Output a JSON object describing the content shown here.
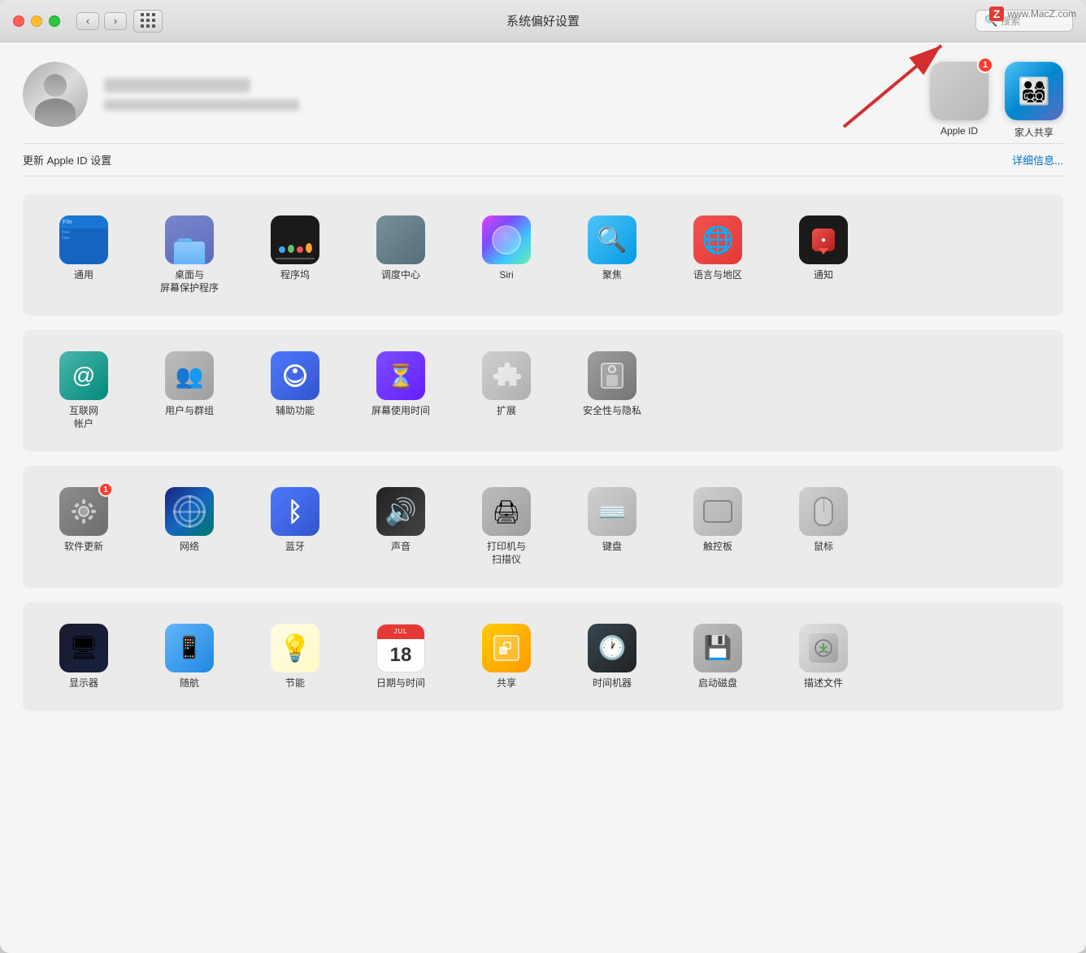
{
  "window": {
    "title": "系统偏好设置",
    "watermark": "www.MacZ.com"
  },
  "titlebar": {
    "back_label": "‹",
    "forward_label": "›",
    "search_placeholder": "搜索"
  },
  "profile": {
    "update_text": "更新 Apple ID 设置",
    "update_link": "详细信息..."
  },
  "top_icons": [
    {
      "id": "apple-id",
      "label": "Apple ID",
      "badge": "1"
    },
    {
      "id": "family-sharing",
      "label": "家人共享"
    }
  ],
  "sections": [
    {
      "id": "section1",
      "items": [
        {
          "id": "general",
          "label": "通用"
        },
        {
          "id": "desktop",
          "label": "桌面与\n屏幕保护程序"
        },
        {
          "id": "dock",
          "label": "程序坞"
        },
        {
          "id": "mission",
          "label": "调度中心"
        },
        {
          "id": "siri",
          "label": "Siri"
        },
        {
          "id": "spotlight",
          "label": "聚焦"
        },
        {
          "id": "language",
          "label": "语言与地区"
        },
        {
          "id": "notification",
          "label": "通知"
        }
      ]
    },
    {
      "id": "section2",
      "items": [
        {
          "id": "internet",
          "label": "互联网\n帐户"
        },
        {
          "id": "users",
          "label": "用户与群组"
        },
        {
          "id": "accessibility",
          "label": "辅助功能"
        },
        {
          "id": "screentime",
          "label": "屏幕使用时间"
        },
        {
          "id": "extensions",
          "label": "扩展"
        },
        {
          "id": "security",
          "label": "安全性与隐私"
        }
      ]
    },
    {
      "id": "section3",
      "items": [
        {
          "id": "softwareupdate",
          "label": "软件更新",
          "badge": "1"
        },
        {
          "id": "network",
          "label": "网络"
        },
        {
          "id": "bluetooth",
          "label": "蓝牙"
        },
        {
          "id": "sound",
          "label": "声音"
        },
        {
          "id": "printer",
          "label": "打印机与\n扫描仪"
        },
        {
          "id": "keyboard",
          "label": "键盘"
        },
        {
          "id": "trackpad",
          "label": "触控板"
        },
        {
          "id": "mouse",
          "label": "鼠标"
        }
      ]
    },
    {
      "id": "section4",
      "items": [
        {
          "id": "display",
          "label": "显示器"
        },
        {
          "id": "airdrop",
          "label": "随航"
        },
        {
          "id": "energy",
          "label": "节能"
        },
        {
          "id": "datetime",
          "label": "日期与时间"
        },
        {
          "id": "sharing",
          "label": "共享"
        },
        {
          "id": "timemachine",
          "label": "时间机器"
        },
        {
          "id": "startup",
          "label": "启动磁盘"
        },
        {
          "id": "profile",
          "label": "描述文件"
        }
      ]
    }
  ]
}
